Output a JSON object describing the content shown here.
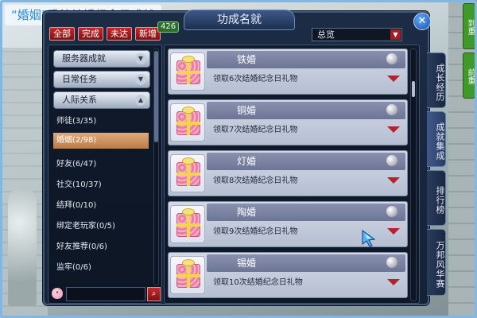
{
  "caption": "“婚姻”系统结婚纪念日成就",
  "window": {
    "title": "功成名就",
    "close_label": "✕"
  },
  "filters": [
    {
      "label": "全部"
    },
    {
      "label": "完成"
    },
    {
      "label": "未达"
    },
    {
      "label": "新增"
    }
  ],
  "new_count": "426",
  "dropdown": {
    "value": "总览"
  },
  "categories": [
    {
      "label": "服务器成就"
    },
    {
      "label": "日常任务"
    },
    {
      "label": "人际关系"
    }
  ],
  "nav_items": [
    {
      "label": "师徒(3/35)"
    },
    {
      "label": "婚姻(2/98)",
      "selected": true
    },
    {
      "label": "好友(6/47)"
    },
    {
      "label": "社交(10/37)"
    },
    {
      "label": "结拜(0/10)"
    },
    {
      "label": "绑定老玩家(0/5)"
    },
    {
      "label": "好友推荐(0/6)"
    },
    {
      "label": "监牢(0/6)"
    }
  ],
  "search": {
    "placeholder": ""
  },
  "achievements": [
    {
      "name": "铁婚",
      "desc": "领取6次结婚纪念日礼物"
    },
    {
      "name": "铜婚",
      "desc": "领取7次结婚纪念日礼物"
    },
    {
      "name": "灯婚",
      "desc": "领取8次结婚纪念日礼物"
    },
    {
      "name": "陶婚",
      "desc": "领取9次结婚纪念日礼物"
    },
    {
      "name": "锡婚",
      "desc": "领取10次结婚纪念日礼物"
    }
  ],
  "side_tabs": [
    {
      "label": "成长经历"
    },
    {
      "label": "成就集成",
      "active": true
    },
    {
      "label": "排行榜"
    },
    {
      "label": "万邦风华赛"
    }
  ],
  "edge_buttons": [
    {
      "label": "到重",
      "color": "#3f9a2a"
    },
    {
      "label": "前重",
      "color": "#3f9a2a"
    }
  ],
  "colors": {
    "caption_text": "#2a8bd6",
    "filter_button": "#c6272a",
    "selected_item": "#d69a66",
    "expand_arrow": "#b6212b"
  }
}
